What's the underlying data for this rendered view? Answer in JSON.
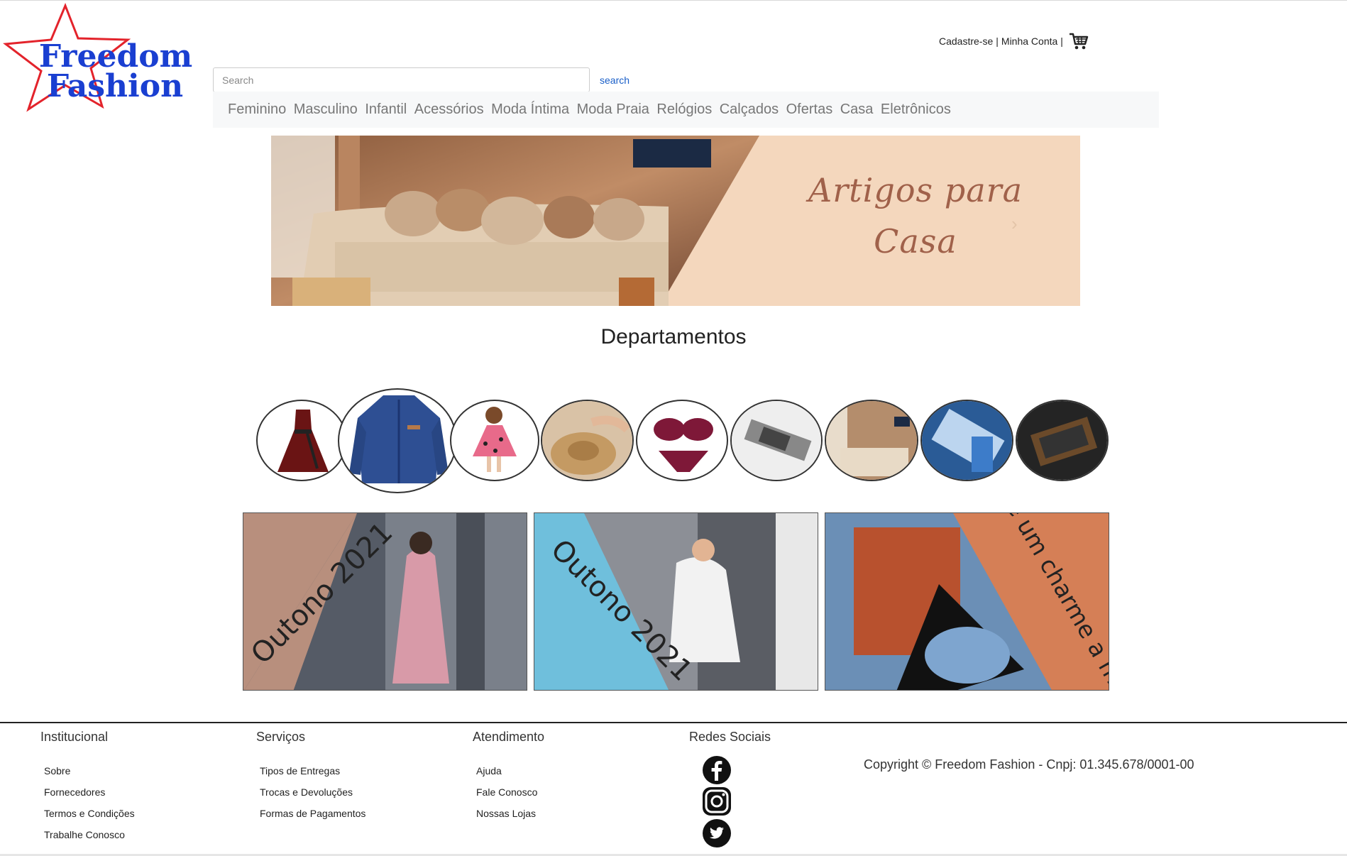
{
  "brand": {
    "line1": "Freedom",
    "line2": "Fashion",
    "color": "#1a3fd1",
    "star_color": "#e3232b"
  },
  "account": {
    "register_label": "Cadastre-se",
    "separator": "|",
    "my_account_label": "Minha Conta",
    "separator2": "|",
    "cart_icon": "cart-icon"
  },
  "search": {
    "placeholder": "Search",
    "button_label": "search"
  },
  "nav": {
    "items": [
      "Feminino",
      "Masculino",
      "Infantil",
      "Acessórios",
      "Moda Íntima",
      "Moda Praia",
      "Relógios",
      "Calçados",
      "Ofertas",
      "Casa",
      "Eletrônicos"
    ]
  },
  "hero": {
    "line1": "Artigos para",
    "line2": "Casa",
    "next_icon": "chevron-right-icon",
    "slides": 3,
    "active_slide": 3
  },
  "departments": {
    "title": "Departamentos",
    "items": [
      "vestido",
      "camisa",
      "infantil",
      "acessorios",
      "moda-intima",
      "relogios",
      "casa",
      "eletronicos",
      "outros"
    ]
  },
  "promos": [
    {
      "text": "Outono 2021",
      "color": "#b88f7d"
    },
    {
      "text": "Outono 2021",
      "color": "#6fbfdc"
    },
    {
      "text": "Dê um charme a mais",
      "color": "#d57f56"
    }
  ],
  "footer": {
    "institucional": {
      "title": "Institucional",
      "links": [
        "Sobre",
        "Fornecedores",
        "Termos e Condições",
        "Trabalhe Conosco"
      ]
    },
    "servicos": {
      "title": "Serviços",
      "links": [
        "Tipos de Entregas",
        "Trocas e Devoluções",
        "Formas de Pagamentos"
      ]
    },
    "atendimento": {
      "title": "Atendimento",
      "links": [
        "Ajuda",
        "Fale Conosco",
        "Nossas Lojas"
      ]
    },
    "redes": {
      "title": "Redes Sociais",
      "icons": [
        "facebook-icon",
        "instagram-icon",
        "twitter-icon"
      ]
    },
    "copyright": "Copyright © Freedom Fashion - Cnpj: 01.345.678/0001-00"
  }
}
